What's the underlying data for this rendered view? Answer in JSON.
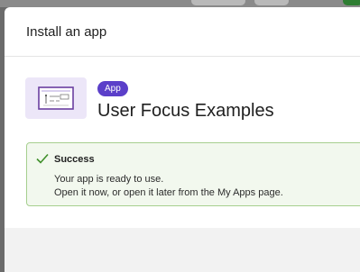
{
  "modal": {
    "title": "Install an app"
  },
  "app": {
    "badge": "App",
    "name": "User Focus Examples",
    "thumbnail_icon": "app-preview-thumbnail"
  },
  "alert": {
    "icon": "check-icon",
    "title": "Success",
    "line1": "Your app is ready to use.",
    "line2": "Open it now, or open it later from the My Apps page."
  },
  "colors": {
    "badge": "#5b3fc9",
    "alert_border": "#a6cf8f",
    "alert_background": "#f2f8ee",
    "check": "#3f8f2a"
  }
}
